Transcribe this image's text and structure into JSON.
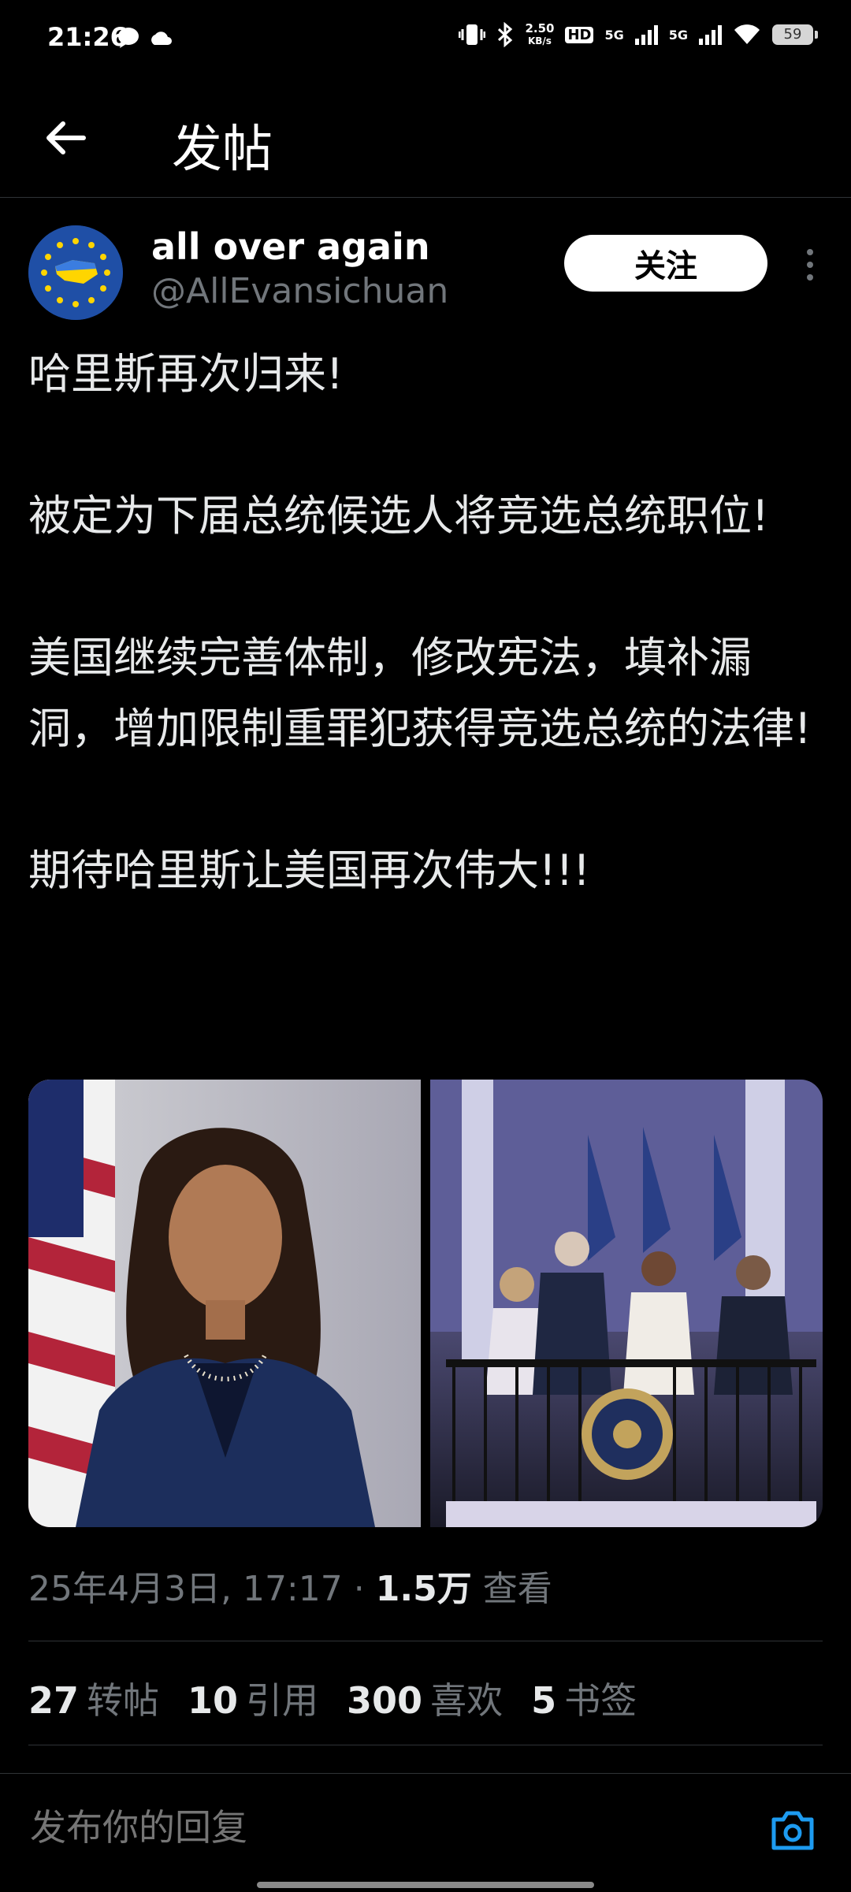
{
  "status_bar": {
    "time": "21:26",
    "speed_value": "2.50",
    "speed_unit": "KB/s",
    "hd_label": "HD",
    "network_1": "5G",
    "network_2": "5G",
    "battery": "59"
  },
  "header": {
    "title": "发帖",
    "back_icon": "arrow-left-icon"
  },
  "post": {
    "author_name": "all over again",
    "author_handle": "@AllEvansichuan",
    "follow_label": "关注",
    "paragraphs": [
      "哈里斯再次归来!",
      "被定为下届总统候选人将竞选总统职位!",
      "美国继续完善体制，修改宪法，填补漏洞，增加限制重罪犯获得竞选总统的法律!",
      "期待哈里斯让美国再次伟大!!!"
    ],
    "date_time": "25年4月3日, 17:17",
    "separator": "·",
    "views_count": "1.5万",
    "views_label": "查看",
    "stats": [
      {
        "count": "27",
        "label": "转帖"
      },
      {
        "count": "10",
        "label": "引用"
      },
      {
        "count": "300",
        "label": "喜欢"
      },
      {
        "count": "5",
        "label": "书签"
      }
    ]
  },
  "reply": {
    "placeholder": "发布你的回复",
    "camera_icon": "camera-icon"
  },
  "colors": {
    "background": "#000000",
    "text": "#e7e9ea",
    "muted": "#71767b",
    "accent": "#1d9bf0"
  }
}
